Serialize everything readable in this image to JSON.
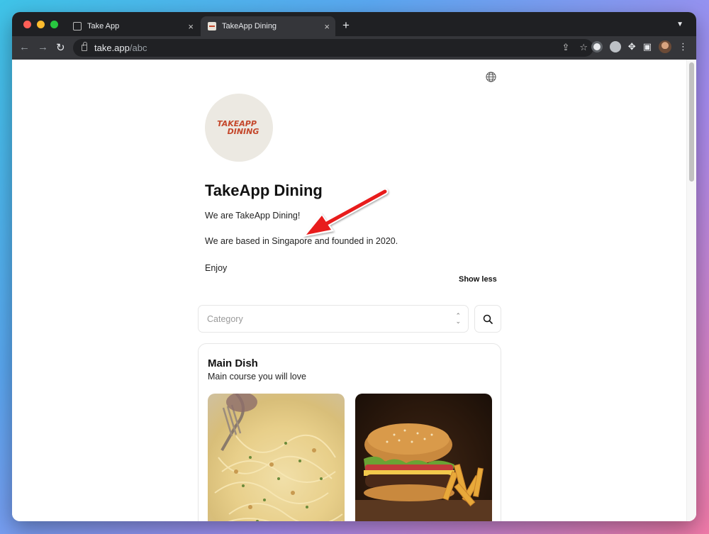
{
  "browser": {
    "tabs": [
      {
        "label": "Take App",
        "active": false
      },
      {
        "label": "TakeApp Dining",
        "active": true
      }
    ],
    "url_host": "take.app",
    "url_path": "/abc"
  },
  "page": {
    "logo_line1": "TAKEAPP",
    "logo_line2": "DINING",
    "title": "TakeApp Dining",
    "description_lines": [
      "We are TakeApp Dining!",
      "We are based in Singapore and founded in 2020.",
      "Enjoy"
    ],
    "show_less": "Show less",
    "category_placeholder": "Category",
    "section": {
      "title": "Main Dish",
      "subtitle": "Main course you will love"
    }
  },
  "colors": {
    "accent": "#c4472b",
    "annotation_arrow": "#e81c1c"
  }
}
